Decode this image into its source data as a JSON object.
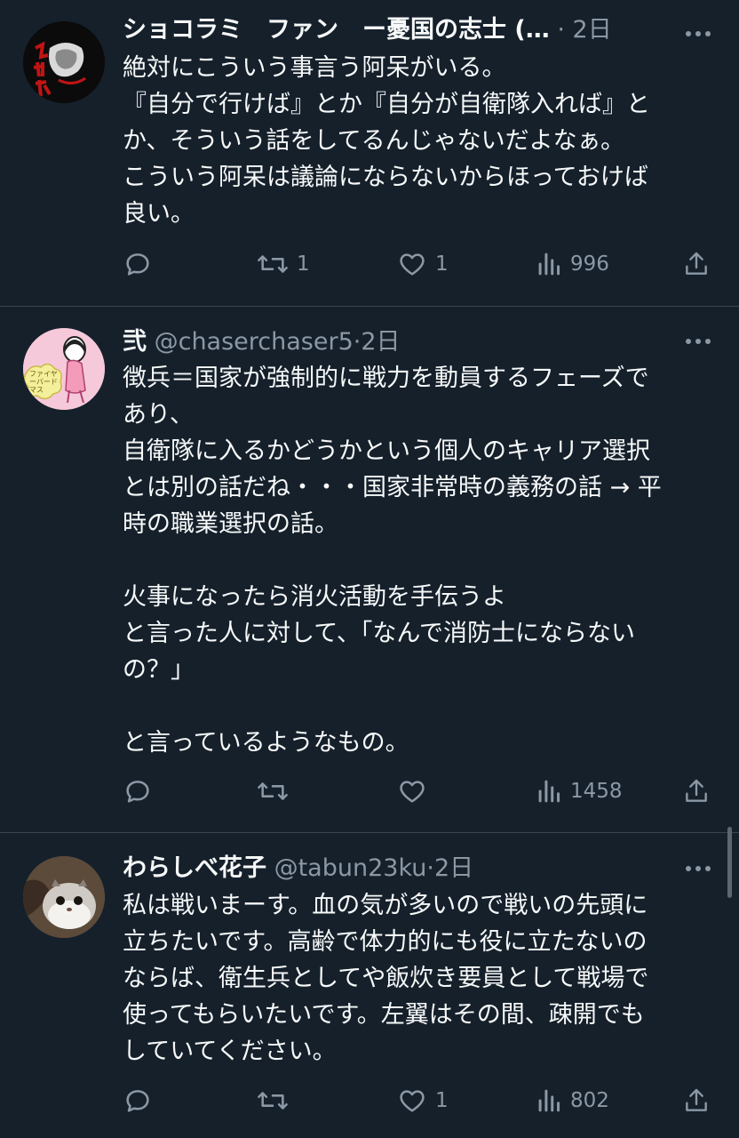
{
  "tweets": [
    {
      "name": "ショコラミ　ファン　ー憂国の志士 (…",
      "handle": "",
      "dot": "·",
      "time": "2日",
      "lines": [
        "絶対にこういう事言う阿呆がいる。",
        "『自分で行けば』とか『自分が自衛隊入れば』と",
        "か、そういう話をしてるんじゃないだよなぁ。",
        "こういう阿呆は議論にならないからほっておけば",
        "良い。"
      ],
      "replies": "",
      "retweets": "1",
      "likes": "1",
      "views": "996"
    },
    {
      "name": "弐",
      "handle": "@chaserchaser5",
      "dot": "·",
      "time": "2日",
      "avatar_text": "ファイヤーバードマス",
      "lines": [
        "徴兵＝国家が強制的に戦力を動員するフェーズで",
        "あり、",
        "自衛隊に入るかどうかという個人のキャリア選択",
        "とは別の話だね・・・国家非常時の義務の話 → 平",
        "時の職業選択の話。",
        "",
        "火事になったら消火活動を手伝うよ",
        "と言った人に対して、「なんで消防士にならない",
        "の？」",
        "",
        "と言っているようなもの。"
      ],
      "replies": "",
      "retweets": "",
      "likes": "",
      "views": "1458"
    },
    {
      "name": "わらしべ花子",
      "handle": "@tabun23ku",
      "dot": "·",
      "time": "2日",
      "lines": [
        "私は戦いまーす。血の気が多いので戦いの先頭に",
        "立ちたいです。高齢で体力的にも役に立たないの",
        "ならば、衛生兵としてや飯炊き要員として戦場で",
        "使ってもらいたいです。左翼はその間、疎開でも",
        "していてください。"
      ],
      "replies": "",
      "retweets": "",
      "likes": "1",
      "views": "802"
    }
  ],
  "icons": {
    "reply": "reply-icon",
    "retweet": "retweet-icon",
    "like": "heart-icon",
    "views": "views-icon",
    "share": "share-icon",
    "more": "more-icon"
  },
  "colors": {
    "background": "#15202b",
    "text": "#f7f9f9",
    "secondary": "#8b98a5",
    "divider": "#38444d"
  }
}
